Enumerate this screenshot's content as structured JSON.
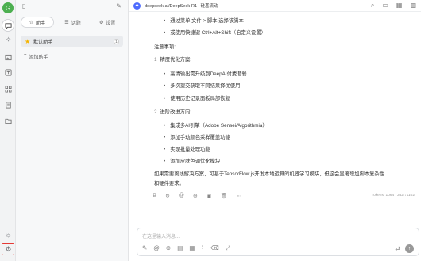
{
  "rail": {
    "avatar_letter": "G",
    "icons": [
      "chat-icon",
      "sparkle-icon",
      "image-icon",
      "translate-icon",
      "apps-icon",
      "files-icon",
      "folder-icon"
    ],
    "bottom_icons": [
      "theme-icon",
      "settings-icon"
    ]
  },
  "panel": {
    "tabs": [
      {
        "label": "助手",
        "icon": "☆"
      },
      {
        "label": "话题",
        "icon": "☰"
      },
      {
        "label": "设置",
        "icon": "⚙"
      }
    ],
    "assistant_name": "默认助手",
    "assistant_count": "1",
    "add_assistant": "添加助手"
  },
  "topbar": {
    "model_name": "deepseek-ai/DeepSeek-R1 | 硅基流动"
  },
  "message": {
    "lines_top": [
      "通过菜单 文件 > 脚本 选择该脚本",
      "或使用快捷键 Ctrl+Alt+Shift（自定义设置）"
    ],
    "notes_title": "注意事项:",
    "section1_num": "1",
    "section1_title": "精度优化方案:",
    "section1_items": [
      "高清输出需升级到DeepAI付费套餐",
      "多次提交获取不同结果择优使用",
      "使用历史记录面板局部恢复"
    ],
    "section2_num": "2",
    "section2_title": "进阶改进方向:",
    "section2_items": [
      "集成多AI引擎（Adobe Sensei/Algorithmia）",
      "添加手动颜色采样覆盖功能",
      "实现批量处理功能",
      "添加皮肤色调优化模块"
    ],
    "footer_line1": "如果需要离线解决方案，可基于TensorFlow.js开发本地运算的机器学习模块，但这会显著增加脚本复杂性",
    "footer_line2": "和硬件要求。",
    "tokens": "Tokens: 1064 ↑362 ↓1102"
  },
  "composer": {
    "placeholder": "在这里输入消息..."
  }
}
